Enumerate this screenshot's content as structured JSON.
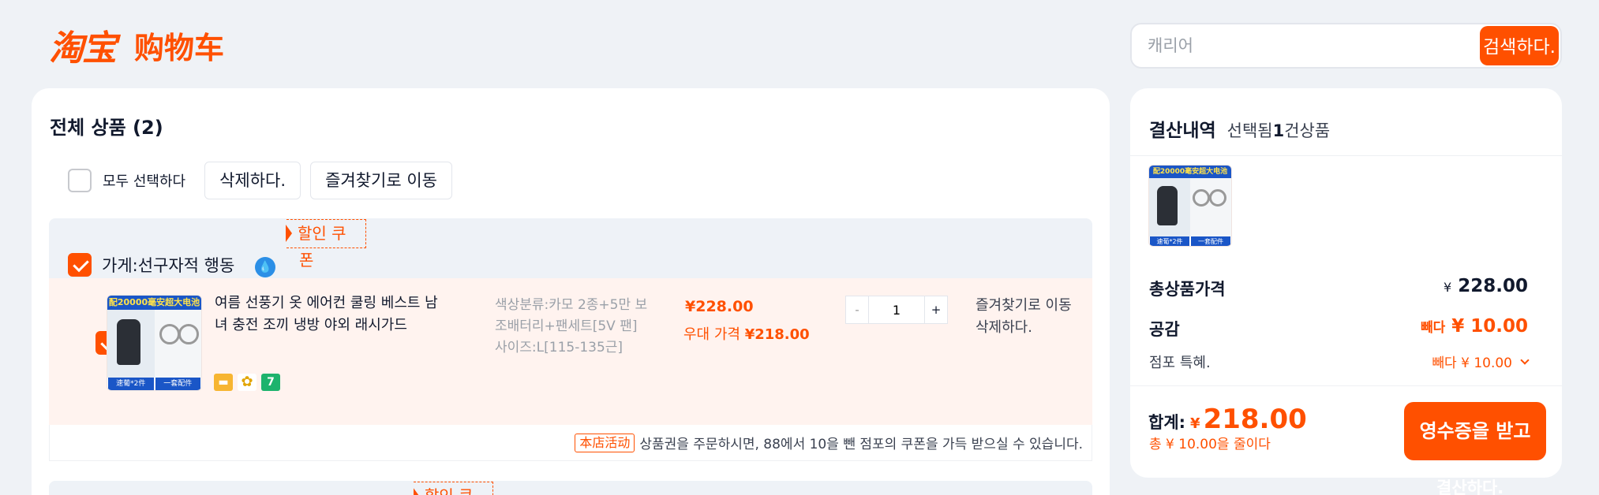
{
  "header": {
    "brand": "淘宝",
    "page_title": "购物车",
    "search_placeholder": "캐리어",
    "search_button": "검색하다."
  },
  "cart": {
    "title": "전체 상품 (2)",
    "select_all_label": "모두 선택하다",
    "delete_label": "삭제하다.",
    "move_favorites_label": "즐겨찾기로 이동",
    "stores": [
      {
        "name": "가게:선구자적 행동",
        "coupon_line1": "할인 쿠",
        "coupon_line2": "폰",
        "items": [
          {
            "checked": true,
            "thumb_banner": "配20000毫安超大电池",
            "thumb_tag_left": "速葡*2件",
            "thumb_tag_right": "一套配件",
            "title": "여름 선풍기 옷 에어컨 쿨링 베스트 남녀 충전 조끼 냉방 야외 래시가드",
            "sku_color": "색상분류:카모 2종+5만 보조배터리+팬세트[5V 팬]",
            "sku_size": "사이즈:L[115-135근]",
            "price": "¥228.00",
            "discount_label": "우대 가격",
            "discount_price": "¥218.00",
            "quantity": "1",
            "op_favorite": "즐겨찾기로 이동",
            "op_delete": "삭제하다."
          }
        ],
        "promo_tag": "本店活动",
        "promo_text": "상품권을 주문하시면, 88에서 10을 뺀 점포의 쿠폰을 가득 받으실 수 있습니다."
      },
      {
        "coupon_line1": "할인 쿠"
      }
    ]
  },
  "summary": {
    "title": "결산내역",
    "selected_prefix": "선택됨",
    "selected_count": "1",
    "selected_suffix": "건상품",
    "total_label": "총상품가격",
    "total_currency": "¥",
    "total_value": "228.00",
    "discount_label": "공감",
    "discount_prefix": "빼다",
    "discount_value": "¥ 10.00",
    "shop_label": "점포 특혜.",
    "shop_value": "빼다 ¥ 10.00",
    "pay_label": "합계:",
    "pay_currency": "¥",
    "pay_value": "218.00",
    "save_text": "총 ¥ 10.00을 줄이다",
    "checkout_button": "영수증을 받고",
    "checkout_sub": "결산하다."
  },
  "colors": {
    "accent": "#ff5000",
    "background": "#eff2f6",
    "item_highlight": "#fff3ef"
  }
}
